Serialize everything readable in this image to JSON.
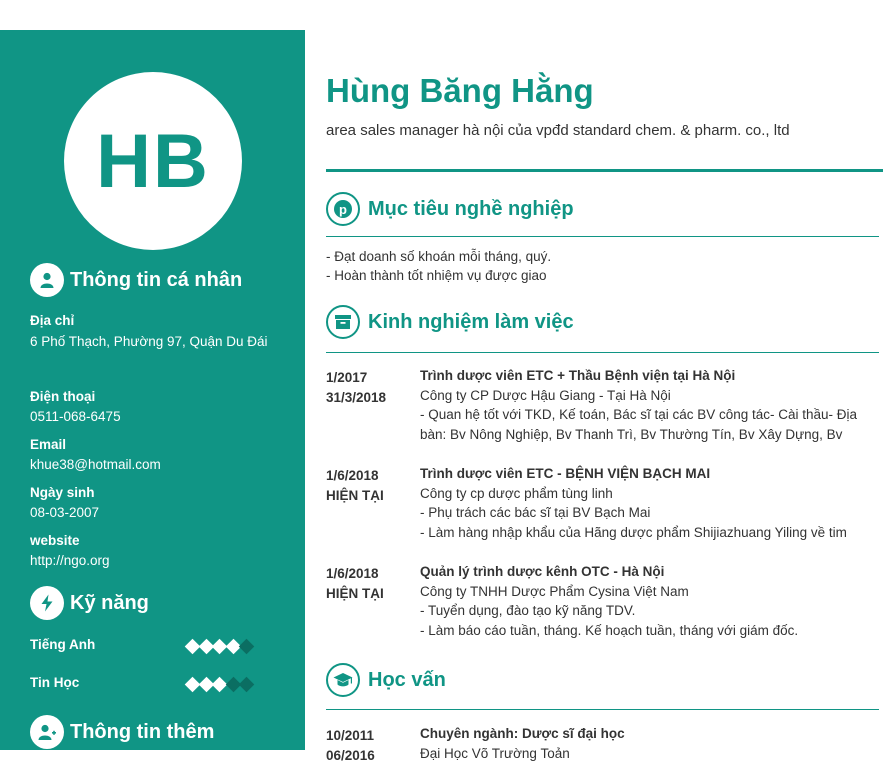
{
  "profile": {
    "initials": "HB",
    "name": "Hùng Băng Hằng",
    "title": "area sales manager hà nội của vpđd standard chem. & pharm. co., ltd"
  },
  "personal": {
    "heading": "Thông tin cá nhân",
    "address_label": "Địa chỉ",
    "address": "6 Phố Thạch, Phường 97, Quận Du Đái",
    "phone_label": "Điện thoại",
    "phone": "0511-068-6475",
    "email_label": "Email",
    "email": "khue38@hotmail.com",
    "dob_label": "Ngày sinh",
    "dob": "08-03-2007",
    "website_label": "website",
    "website": "http://ngo.org"
  },
  "skills": {
    "heading": "Kỹ năng",
    "items": [
      {
        "name": "Tiếng Anh",
        "level": 4,
        "max": 5
      },
      {
        "name": "Tin Học",
        "level": 3,
        "max": 5
      }
    ]
  },
  "more_info": {
    "heading": "Thông tin thêm"
  },
  "objective": {
    "heading": "Mục tiêu nghề nghiệp",
    "lines": [
      "- Đạt doanh số khoán mỗi tháng, quý.",
      "- Hoàn thành tốt nhiệm vụ được giao"
    ]
  },
  "experience": {
    "heading": "Kinh nghiệm làm việc",
    "items": [
      {
        "start": "1/2017",
        "end": "31/3/2018",
        "position": "Trình dược viên ETC + Thầu Bệnh viện tại Hà Nội",
        "company": "Công ty CP Dược Hậu Giang - Tại Hà Nội",
        "details": [
          "- Quan hệ tốt với TKD, Kế toán, Bác sĩ tại các BV công tác- Cài thầu- Địa bàn: Bv Nông Nghiệp, Bv Thanh Trì, Bv Thường Tín, Bv Xây Dựng, Bv"
        ]
      },
      {
        "start": "1/6/2018",
        "end": "HIỆN TẠI",
        "position": "Trình dược viên ETC - BỆNH VIỆN BẠCH MAI",
        "company": "Công ty cp dược phẩm tùng linh",
        "details": [
          "- Phụ trách các bác sĩ tại BV Bạch Mai",
          "- Làm hàng nhập khẩu của Hãng dược phẩm Shijiazhuang Yiling về tim"
        ]
      },
      {
        "start": "1/6/2018",
        "end": "HIỆN TẠI",
        "position": "Quản lý trình dược kênh OTC - Hà Nội",
        "company": "Công ty TNHH Dược Phẩm Cysina Việt Nam",
        "details": [
          "- Tuyển dụng, đào tạo kỹ năng TDV.",
          "- Làm báo cáo tuần, tháng. Kế hoạch tuần, tháng với giám đốc."
        ]
      }
    ]
  },
  "education": {
    "heading": "Học vấn",
    "items": [
      {
        "start": "10/2011",
        "end": "06/2016",
        "major": "Chuyên ngành: Dược sĩ đại học",
        "school": "Đại Học Võ Trường Toản"
      }
    ]
  },
  "colors": {
    "accent": "#109585",
    "dot_off": "#0b6e62"
  },
  "icons": {
    "personal": "user-icon",
    "skills": "lightning-icon",
    "more": "user-plus-icon",
    "objective": "pinterest-icon",
    "experience": "archive-box-icon",
    "education": "graduation-cap-icon"
  }
}
